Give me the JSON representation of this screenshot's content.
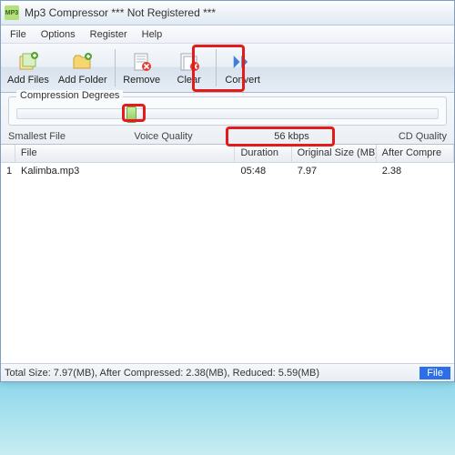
{
  "window": {
    "title": "Mp3 Compressor    *** Not Registered ***",
    "app_icon_label": "MP3"
  },
  "menu": {
    "file": "File",
    "options": "Options",
    "register": "Register",
    "help": "Help"
  },
  "toolbar": {
    "add_files": "Add Files",
    "add_folder": "Add Folder",
    "remove": "Remove",
    "clear": "Clear",
    "convert": "Convert"
  },
  "compression": {
    "group_title": "Compression Degrees",
    "smallest": "Smallest File",
    "voice": "Voice Quality",
    "kbps": "56 kbps",
    "cd": "CD Quality",
    "slider_percent": 26
  },
  "table": {
    "headers": {
      "file": "File",
      "duration": "Duration",
      "original": "Original Size (MB)",
      "after": "After Compre"
    },
    "rows": [
      {
        "num": "1",
        "file": "Kalimba.mp3",
        "duration": "05:48",
        "original": "7.97",
        "after": "2.38"
      }
    ]
  },
  "status": {
    "summary": "Total Size: 7.97(MB), After Compressed: 2.38(MB), Reduced: 5.59(MB)",
    "badge": "File"
  }
}
